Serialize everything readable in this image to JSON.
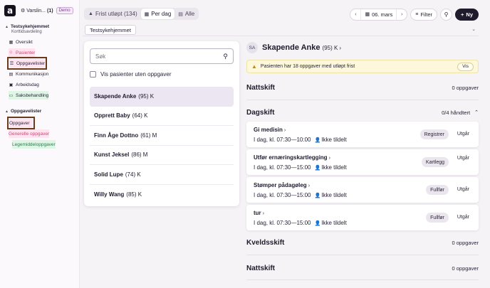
{
  "app": {
    "logo_letter": "a",
    "alert_label": "Varslin...",
    "alert_count": "(1)",
    "demo_badge": "Demo"
  },
  "sidebar": {
    "unit_title": "Testsykehjemmet",
    "unit_subtitle": "Korttidsavdeling",
    "items": [
      {
        "label": "Oversikt",
        "icon": "grid-icon"
      },
      {
        "label": "Pasienter",
        "icon": "user-icon"
      },
      {
        "label": "Oppgavelister",
        "icon": "list-icon"
      },
      {
        "label": "Kommunikasjon",
        "icon": "chat-icon"
      },
      {
        "label": "Arbeidsdag",
        "icon": "briefcase-icon"
      },
      {
        "label": "Saksbehandling",
        "icon": "folder-icon"
      }
    ],
    "section2_title": "Oppgavelister",
    "section2_items": [
      {
        "label": "Oppgaver"
      },
      {
        "label": "Generelle oppgaver"
      },
      {
        "label": "Legemiddeloppgaver"
      }
    ]
  },
  "topbar": {
    "tabs": [
      {
        "label": "Frist utløpt (134)",
        "icon": "warning-icon"
      },
      {
        "label": "Per dag",
        "icon": "calendar-icon"
      },
      {
        "label": "Alle",
        "icon": "list-icon"
      }
    ],
    "date_label": "06. mars",
    "filter_label": "Filter",
    "new_label": "Ny"
  },
  "ward": {
    "label": "Testsykehjemmet"
  },
  "patient_list": {
    "search_placeholder": "Søk",
    "show_without_tasks_label": "Vis pasienter uten oppgaver",
    "patients": [
      {
        "name": "Skapende Anke",
        "meta": "(95) K"
      },
      {
        "name": "Opprett Baby",
        "meta": "(64) K"
      },
      {
        "name": "Finn Åge Dottno",
        "meta": "(61) M"
      },
      {
        "name": "Kunst Jeksel",
        "meta": "(86) M"
      },
      {
        "name": "Solid Lupe",
        "meta": "(74) K"
      },
      {
        "name": "Willy Wang",
        "meta": "(85) K"
      }
    ]
  },
  "detail": {
    "avatar_initials": "SA",
    "patient_name": "Skapende Anke",
    "patient_meta": "(95) K",
    "warning_text": "Pasienten har 18 oppgaver med utløpt frist",
    "warning_button": "Vis",
    "night1": {
      "title": "Nattskift",
      "status": "0 oppgaver"
    },
    "day": {
      "title": "Dagskift",
      "status": "0/4 håndtert"
    },
    "tasks": [
      {
        "title": "Gi medisin",
        "time": "I dag, kl. 07:30—10:00",
        "assignee": "Ikke tildelt",
        "action": "Registrer",
        "secondary": "Utgår"
      },
      {
        "title": "Utfør ernæringskartlegging",
        "time": "I dag, kl. 07:30—15:00",
        "assignee": "Ikke tildelt",
        "action": "Kartlegg",
        "secondary": "Utgår"
      },
      {
        "title": "Stømper pådagøleg",
        "time": "I dag, kl. 07:30—15:00",
        "assignee": "Ikke tildelt",
        "action": "Fullfør",
        "secondary": "Utgår"
      },
      {
        "title": "tur",
        "time": "I dag, kl. 07:30—15:00",
        "assignee": "Ikke tildelt",
        "action": "Fullfør",
        "secondary": "Utgår"
      }
    ],
    "evening": {
      "title": "Kveldsskift",
      "status": "0 oppgaver"
    },
    "night2": {
      "title": "Nattskift",
      "status": "0 oppgaver"
    }
  }
}
